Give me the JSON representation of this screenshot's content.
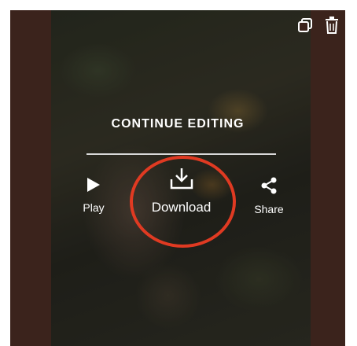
{
  "editor": {
    "continue_label": "CONTINUE EDITING",
    "actions": {
      "play_label": "Play",
      "download_label": "Download",
      "share_label": "Share"
    }
  },
  "toolbar": {
    "icons": [
      "duplicate-icon",
      "trash-icon"
    ]
  },
  "colors": {
    "highlight": "#e03a22",
    "background": "#3b231c",
    "text": "#ffffff"
  }
}
